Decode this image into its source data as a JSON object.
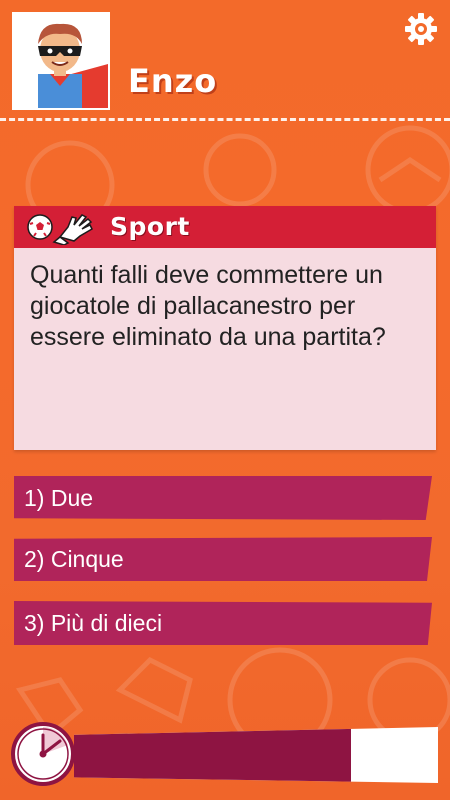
{
  "player": {
    "name": "Enzo",
    "avatar_icon": "superhero-avatar-icon"
  },
  "header": {
    "settings_icon": "gear-icon"
  },
  "card": {
    "category": "Sport",
    "category_icons": [
      "soccer-ball-icon",
      "goalkeeper-glove-icon"
    ],
    "question": "Quanti falli deve commettere un giocatole di pallacanestro per essere eliminato da una partita?"
  },
  "answers": [
    {
      "label": "1) Due"
    },
    {
      "label": "2) Cinque"
    },
    {
      "label": "3) Più di dieci"
    }
  ],
  "timer": {
    "remaining_fraction": 0.76,
    "icon": "clock-icon"
  },
  "colors": {
    "background": "#f36a2a",
    "card_header": "#d41f36",
    "card_body": "#f6dbe1",
    "answer": "#b0245a",
    "timer_fill": "#8e1442"
  }
}
